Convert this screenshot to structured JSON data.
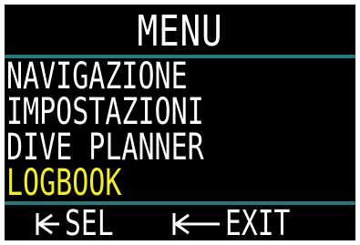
{
  "header": {
    "title": "MENU"
  },
  "menu": {
    "items": [
      {
        "label": "NAVIGAZIONE",
        "selected": false
      },
      {
        "label": "IMPOSTAZIONI",
        "selected": false
      },
      {
        "label": "DIVE PLANNER",
        "selected": false
      },
      {
        "label": "LOGBOOK",
        "selected": true
      }
    ]
  },
  "footer": {
    "select_label": "SEL",
    "select_icon": "short-arrow-left-to-bar-icon",
    "exit_label": "EXIT",
    "exit_icon": "long-arrow-left-to-bar-icon"
  },
  "colors": {
    "background": "#000000",
    "text": "#ffffff",
    "selected_text": "#f2ef1c",
    "divider": "#1f7b7e"
  }
}
